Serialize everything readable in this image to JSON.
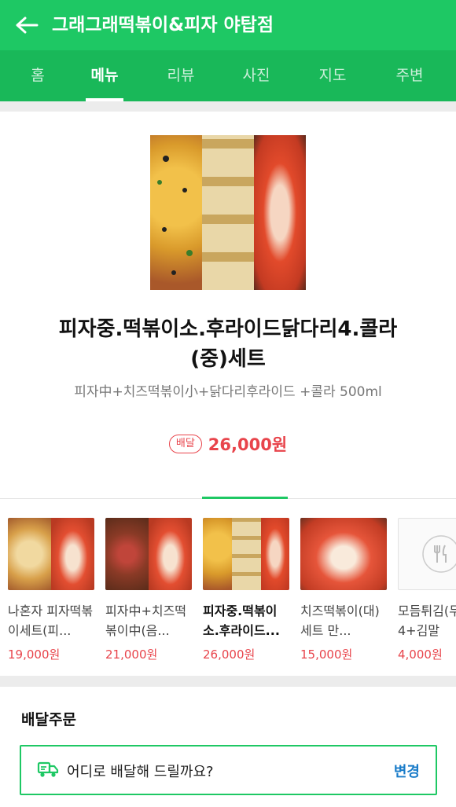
{
  "header": {
    "title": "그래그래떡볶이&피자 야탑점",
    "back_icon": "back-arrow-icon"
  },
  "tabs": [
    {
      "label": "홈"
    },
    {
      "label": "메뉴"
    },
    {
      "label": "리뷰"
    },
    {
      "label": "사진"
    },
    {
      "label": "지도"
    },
    {
      "label": "주변"
    }
  ],
  "active_tab": "메뉴",
  "menu": {
    "name_line1": "피자중.떡볶이소.후라이드닭다리4.콜라",
    "name_line2": "(중)세트",
    "description": "피자中+치즈떡볶이小+닭다리후라이드 +콜라 500ml",
    "badge": "배달",
    "price": "26,000원"
  },
  "related": [
    {
      "title": "나혼자 피자떡볶이세트(피...",
      "price": "19,000원"
    },
    {
      "title": "피자中+치즈떡볶이中(음...",
      "price": "21,000원"
    },
    {
      "title": "피자중.떡볶이소.후라이드...",
      "price": "26,000원"
    },
    {
      "title": "치즈떡볶이(대)세트 만...",
      "price": "15,000원"
    },
    {
      "title": "모듬튀김(두4+김말",
      "price": "4,000원"
    }
  ],
  "delivery": {
    "section_title": "배달주문",
    "address_placeholder": "어디로 배달해 드릴까요?",
    "change_label": "변경",
    "icon": "delivery-truck-icon"
  },
  "colors": {
    "brand_green": "#1ec864",
    "price_red": "#e8444b",
    "link_blue": "#1a7cc9"
  }
}
